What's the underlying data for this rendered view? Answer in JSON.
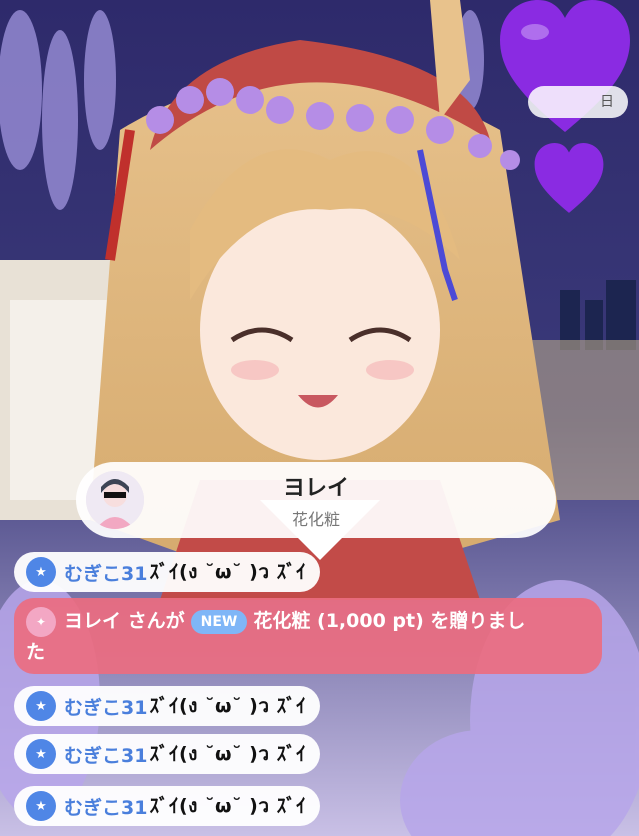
{
  "date_label": "日",
  "gift_popup": {
    "sender_name": "ヨレイ",
    "gift_name": "花化粧",
    "avatar_icon": "user-avatar-icon"
  },
  "gift_banner": {
    "sender": "ヨレイ",
    "middle": "さんが",
    "new_tag": "NEW",
    "tail_line1": "花化粧 (1,000 pt) を贈りまし",
    "tail_line2": "た"
  },
  "comments_before": [
    {
      "user": "むぎこ31",
      "text": "ｽﾞｲ(ง ˘ω˘ )ว ｽﾞｲ"
    }
  ],
  "comments_after": [
    {
      "user": "むぎこ31",
      "text": "ｽﾞｲ(ง ˘ω˘ )ว ｽﾞｲ"
    },
    {
      "user": "むぎこ31",
      "text": "ｽﾞｲ(ง ˘ω˘ )ว ｽﾞｲ"
    },
    {
      "user": "むぎこ31",
      "text": "ｽﾞｲ(ง ˘ω˘ )ว ｽﾞｲ"
    }
  ],
  "colors": {
    "heart": "#8a2be2",
    "banner": "#ec6c80",
    "user_name": "#4a7fdc",
    "badge": "#4f86e6"
  }
}
